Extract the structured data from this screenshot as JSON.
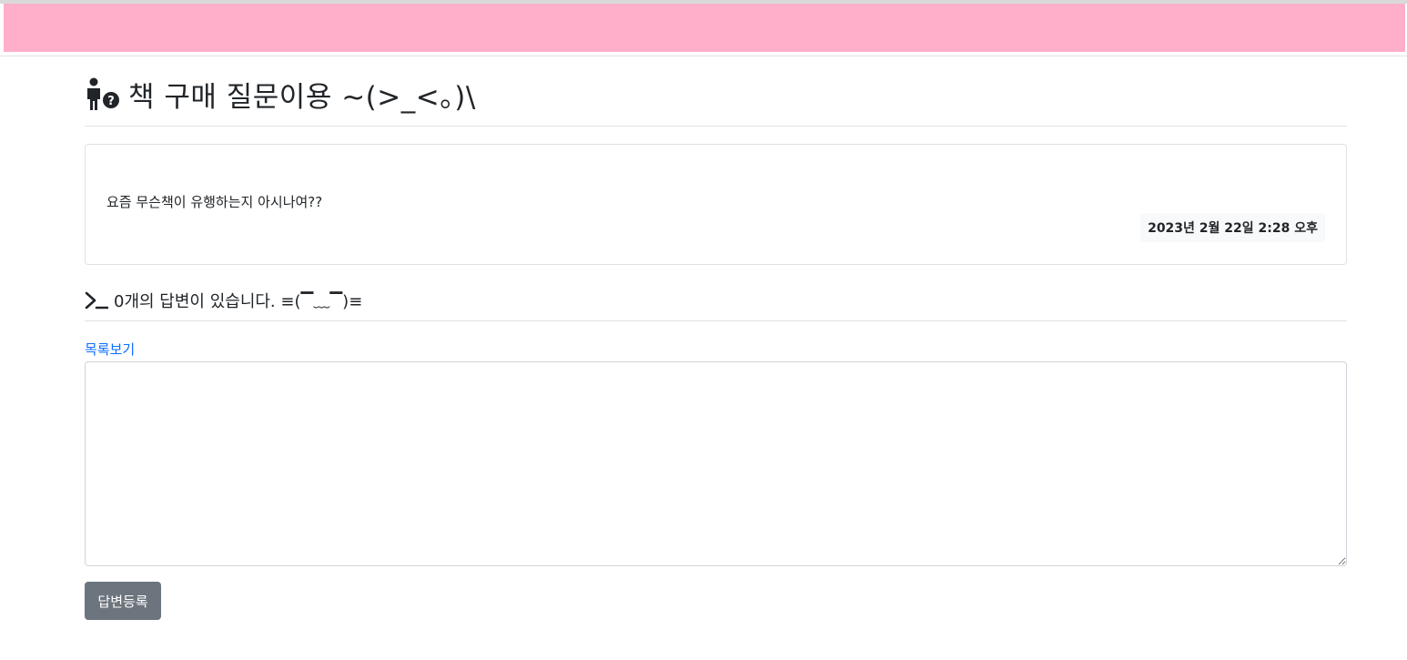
{
  "header": {
    "title": "책 구매 질문이용 ~(>_<。)\\"
  },
  "question": {
    "content": "요즘 무슨책이 유행하는지 아시나여??",
    "date": "2023년 2월 22일 2:28 오후"
  },
  "answers": {
    "count_text": "0개의 답변이 있습니다. ≡(▔﹏▔)≡"
  },
  "actions": {
    "list_link": "목록보기",
    "submit_label": "답변등록"
  },
  "textarea": {
    "value": "",
    "placeholder": ""
  },
  "colors": {
    "banner": "#ffafc9",
    "link": "#0d6efd",
    "button": "#6c757d"
  },
  "icons": {
    "title_icon": "person-question-icon",
    "answers_icon": "terminal-icon"
  }
}
